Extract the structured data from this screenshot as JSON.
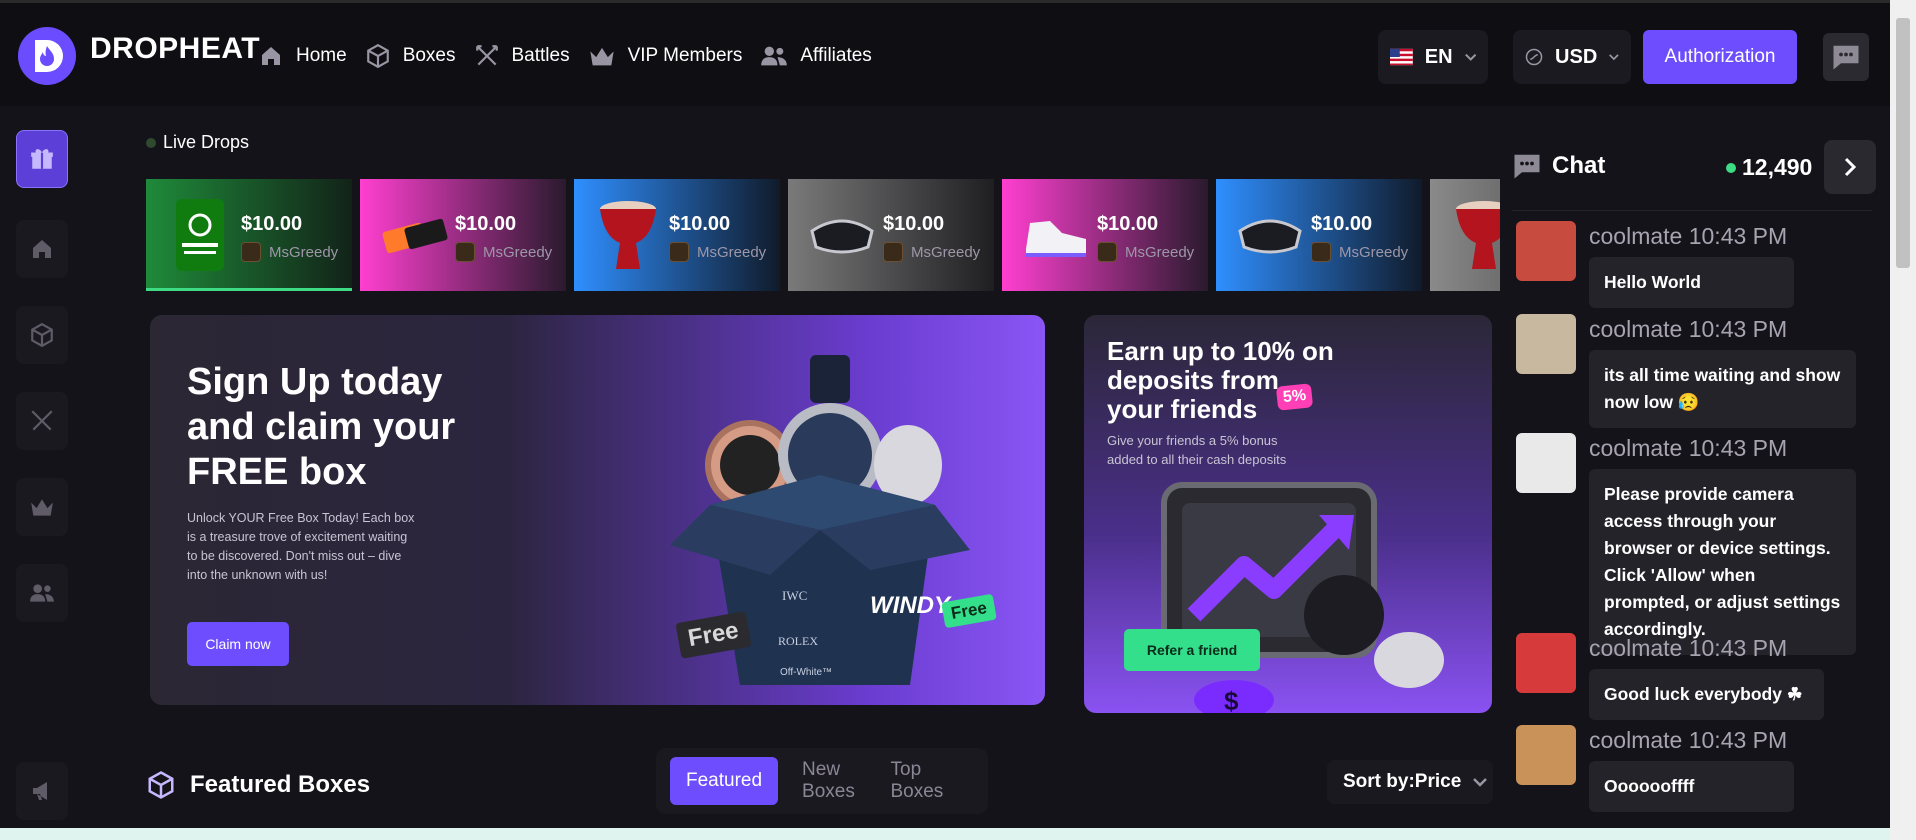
{
  "brand": {
    "name": "DROPHEAT"
  },
  "nav": {
    "items": [
      {
        "label": "Home",
        "icon": "home-icon"
      },
      {
        "label": "Boxes",
        "icon": "box-icon"
      },
      {
        "label": "Battles",
        "icon": "swords-icon"
      },
      {
        "label": "VIP Members",
        "icon": "crown-icon"
      },
      {
        "label": "Affiliates",
        "icon": "users-icon"
      }
    ],
    "language": "EN",
    "currency": "USD",
    "auth_label": "Authorization"
  },
  "live_drops": {
    "label": "Live Drops",
    "items": [
      {
        "price": "$10.00",
        "user": "MsGreedy",
        "item": "xbox-game-pass",
        "bg_from": "#1f8a3a",
        "bg_to": "#122318"
      },
      {
        "price": "$10.00",
        "user": "MsGreedy",
        "item": "tickets",
        "bg_from": "#ff3fd0",
        "bg_to": "#2a1a2e"
      },
      {
        "price": "$10.00",
        "user": "MsGreedy",
        "item": "drum",
        "bg_from": "#2f8fff",
        "bg_to": "#101b2b"
      },
      {
        "price": "$10.00",
        "user": "MsGreedy",
        "item": "vr-headset",
        "bg_from": "#7a7a7a",
        "bg_to": "#1f1f22"
      },
      {
        "price": "$10.00",
        "user": "MsGreedy",
        "item": "sneaker",
        "bg_from": "#ff3fd0",
        "bg_to": "#2a1a2e"
      },
      {
        "price": "$10.00",
        "user": "MsGreedy",
        "item": "vr-headset",
        "bg_from": "#2f8fff",
        "bg_to": "#101b2b"
      },
      {
        "price": "",
        "user": "",
        "item": "drum",
        "bg_from": "#8a8a8a",
        "bg_to": "#3a3a3a"
      }
    ]
  },
  "banner_signup": {
    "headline": "Sign Up today and claim your FREE box",
    "body": "Unlock YOUR Free Box Today! Each box is a treasure trove of excitement waiting to be discovered. Don't miss out – dive into the unknown with us!",
    "cta": "Claim now",
    "box_brands": [
      "IWC",
      "ROLEX",
      "Off-White™"
    ],
    "box_label": "WINDY",
    "free_tag": "Free"
  },
  "banner_affiliate": {
    "headline": "Earn up to 10% on deposits from your friends",
    "badge": "5%",
    "body": "Give your friends a 5% bonus added to all their cash deposits",
    "cta": "Refer a friend"
  },
  "featured": {
    "title": "Featured Boxes",
    "tabs": [
      "Featured",
      "New Boxes",
      "Top Boxes"
    ],
    "sort_label": "Sort by:Price"
  },
  "chat": {
    "title": "Chat",
    "online_count": "12,490",
    "messages": [
      {
        "user": "coolmate",
        "time": "10:43 PM",
        "text": "Hello World",
        "avatar_color": "#c84b3f"
      },
      {
        "user": "coolmate",
        "time": "10:43 PM",
        "text": "its all time waiting and show now low 😥",
        "avatar_color": "#c9b8a0"
      },
      {
        "user": "coolmate",
        "time": "10:43 PM",
        "text": "Please provide camera access through your browser or device settings. Click 'Allow' when prompted, or adjust settings accordingly.",
        "avatar_color": "#e9e9e9"
      },
      {
        "user": "coolmate",
        "time": "10:43 PM",
        "text": "Good luck everybody ☘",
        "avatar_color": "#d63a3a"
      },
      {
        "user": "coolmate",
        "time": "10:43 PM",
        "text": "Ooooooffff",
        "avatar_color": "#c99258"
      }
    ]
  }
}
